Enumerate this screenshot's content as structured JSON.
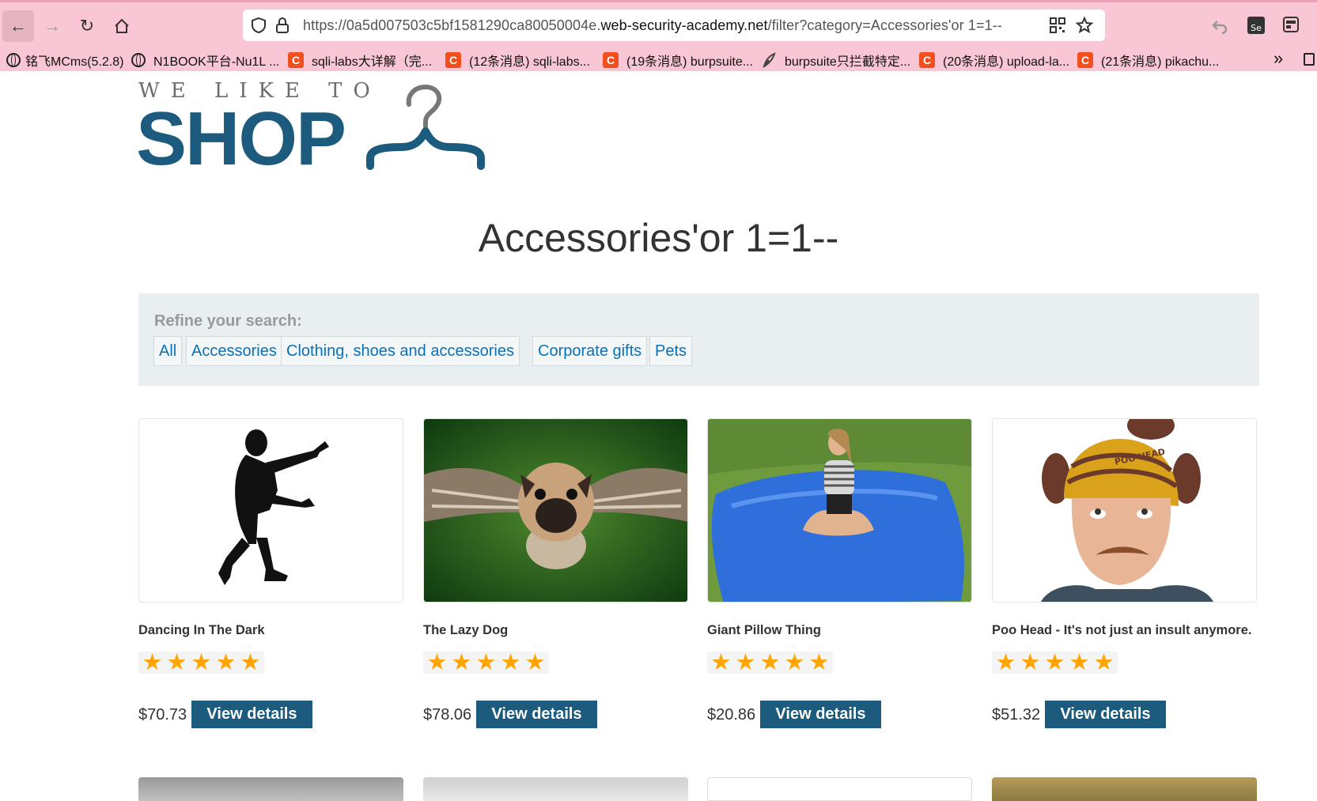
{
  "browser": {
    "url_prefix": "https://0a5d007503c5bf1581290ca80050004e.",
    "url_domain": "web-security-academy.net",
    "url_path": "/filter?category=Accessories'or 1=1--",
    "bookmarks": [
      {
        "label": "铭飞MCms(5.2.8)",
        "icon": "globe-icon"
      },
      {
        "label": "N1BOOK平台-Nu1L ...",
        "icon": "globe-icon"
      },
      {
        "label": "sqli-labs大详解（完...",
        "icon": "csdn-icon"
      },
      {
        "label": "(12条消息) sqli-labs...",
        "icon": "csdn-icon"
      },
      {
        "label": "(19条消息) burpsuite...",
        "icon": "csdn-icon"
      },
      {
        "label": "burpsuite只拦截特定...",
        "icon": "feather-icon"
      },
      {
        "label": "(20条消息) upload-la...",
        "icon": "csdn-icon"
      },
      {
        "label": "(21条消息) pikachu...",
        "icon": "csdn-icon"
      }
    ],
    "bookmark_badge": "C"
  },
  "logo": {
    "tagline": "WE LIKE TO",
    "name": "SHOP"
  },
  "page_title": "Accessories'or 1=1--",
  "refine": {
    "label": "Refine your search:",
    "filters": [
      "All",
      "Accessories",
      "Clothing, shoes and accessories",
      "Corporate gifts",
      "Pets"
    ]
  },
  "products": [
    {
      "name": "Dancing In The Dark",
      "price": "$70.73",
      "rating": 5,
      "button": "View details"
    },
    {
      "name": "The Lazy Dog",
      "price": "$78.06",
      "rating": 5,
      "button": "View details"
    },
    {
      "name": "Giant Pillow Thing",
      "price": "$20.86",
      "rating": 5,
      "button": "View details"
    },
    {
      "name": "Poo Head - It's not just an insult anymore.",
      "price": "$51.32",
      "rating": 5,
      "button": "View details"
    }
  ],
  "product_image_text": {
    "poo_head_hat": "POO HEAD"
  },
  "colors": {
    "brand": "#1c5b7e",
    "link": "#0a71b9",
    "star": "#ffa400",
    "chrome": "#f9c6d6"
  }
}
